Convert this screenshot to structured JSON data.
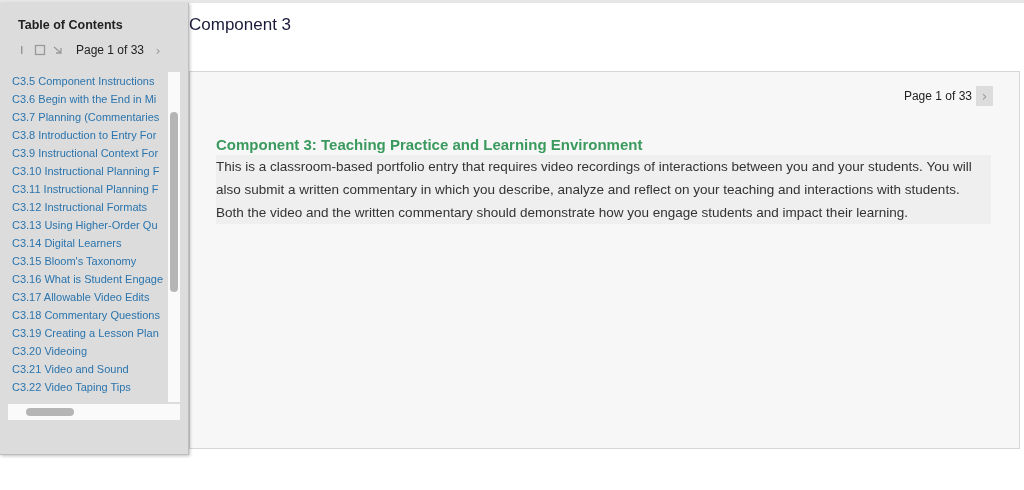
{
  "page_title": "Component 3",
  "sidebar": {
    "title": "Table of Contents",
    "pager": "Page 1 of 33",
    "next": "›",
    "items": [
      "C3.5 Component Instructions",
      "C3.6 Begin with the End in Mi",
      "C3.7 Planning (Commentaries",
      "C3.8 Introduction to Entry For",
      "C3.9 Instructional Context For",
      "C3.10 Instructional Planning F",
      "C3.11 Instructional Planning F",
      "C3.12 Instructional Formats",
      "C3.13 Using Higher-Order Qu",
      "C3.14 Digital Learners",
      "C3.15 Bloom's Taxonomy",
      "C3.16 What is Student Engage",
      "C3.17 Allowable Video Edits",
      "C3.18 Commentary Questions",
      "C3.19 Creating a Lesson Plan",
      "C3.20 Videoing",
      "C3.21 Video and Sound",
      "C3.22 Video Taping Tips"
    ]
  },
  "content": {
    "pager": "Page 1 of 33",
    "next": "›",
    "heading": "Component 3: Teaching Practice and Learning Environment",
    "body": "This is a classroom-based portfolio entry that requires video recordings of interactions between you and your students. You will also submit a written commentary in which you describe, analyze and reflect on your teaching and interactions with students. Both the video and the written commentary should demonstrate how you engage students and impact their learning."
  }
}
